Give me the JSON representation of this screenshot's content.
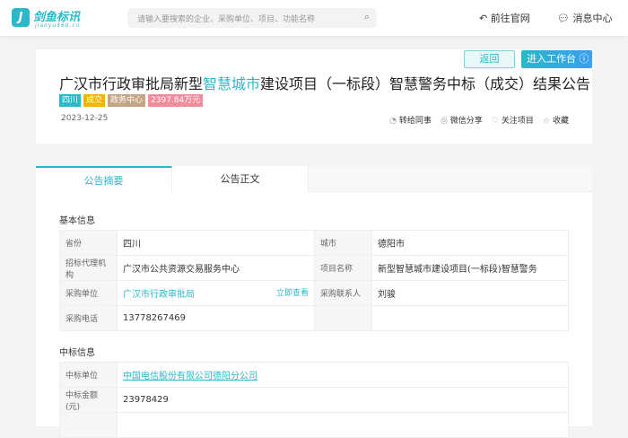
{
  "header": {
    "logo_text": "剑鱼标讯",
    "logo_sub": "jianyu360.cn",
    "search_placeholder": "请输入要搜索的企业、采购单位、项目、功能名称",
    "go_official": "前往官网",
    "messages": "消息中心"
  },
  "notice": {
    "back": "返回",
    "workbench": "进入工作台",
    "title_pre": "广汉市行政审批局新型",
    "title_hi": "智慧城市",
    "title_post": "建设项目（一标段）智慧警务中标（成交）结果公告",
    "tags": [
      {
        "label": "四川",
        "color": "#2bb8c8"
      },
      {
        "label": "成交",
        "color": "#f5b400"
      },
      {
        "label": "政务中心",
        "color": "#c4a484"
      },
      {
        "label": "2397.84万元",
        "color": "#f38b9b"
      }
    ],
    "date": "2023-12-25",
    "actions": [
      "转给同事",
      "微信分享",
      "关注项目",
      "收藏"
    ]
  },
  "tabs": [
    "公告摘要",
    "公告正文"
  ],
  "basic": {
    "title": "基本信息",
    "province_label": "省份",
    "province": "四川",
    "city_label": "城市",
    "city": "德阳市",
    "agency_label": "招标代理机构",
    "agency": "广汉市公共资源交易服务中心",
    "project_label": "项目名称",
    "project": "新型智慧城市建设项目(一标段)智慧警务",
    "buyer_label": "采购单位",
    "buyer": "广汉市行政审批局",
    "view_now": "立即查看",
    "contact_label": "采购联系人",
    "contact": "刘骏",
    "phone_label": "采购电话",
    "phone": "13778267469"
  },
  "winner": {
    "title": "中标信息",
    "unit_label": "中标单位",
    "unit": "中国电信股份有限公司德阳分公司",
    "amount_label": "中标金额(元)",
    "amount": "23978429"
  }
}
